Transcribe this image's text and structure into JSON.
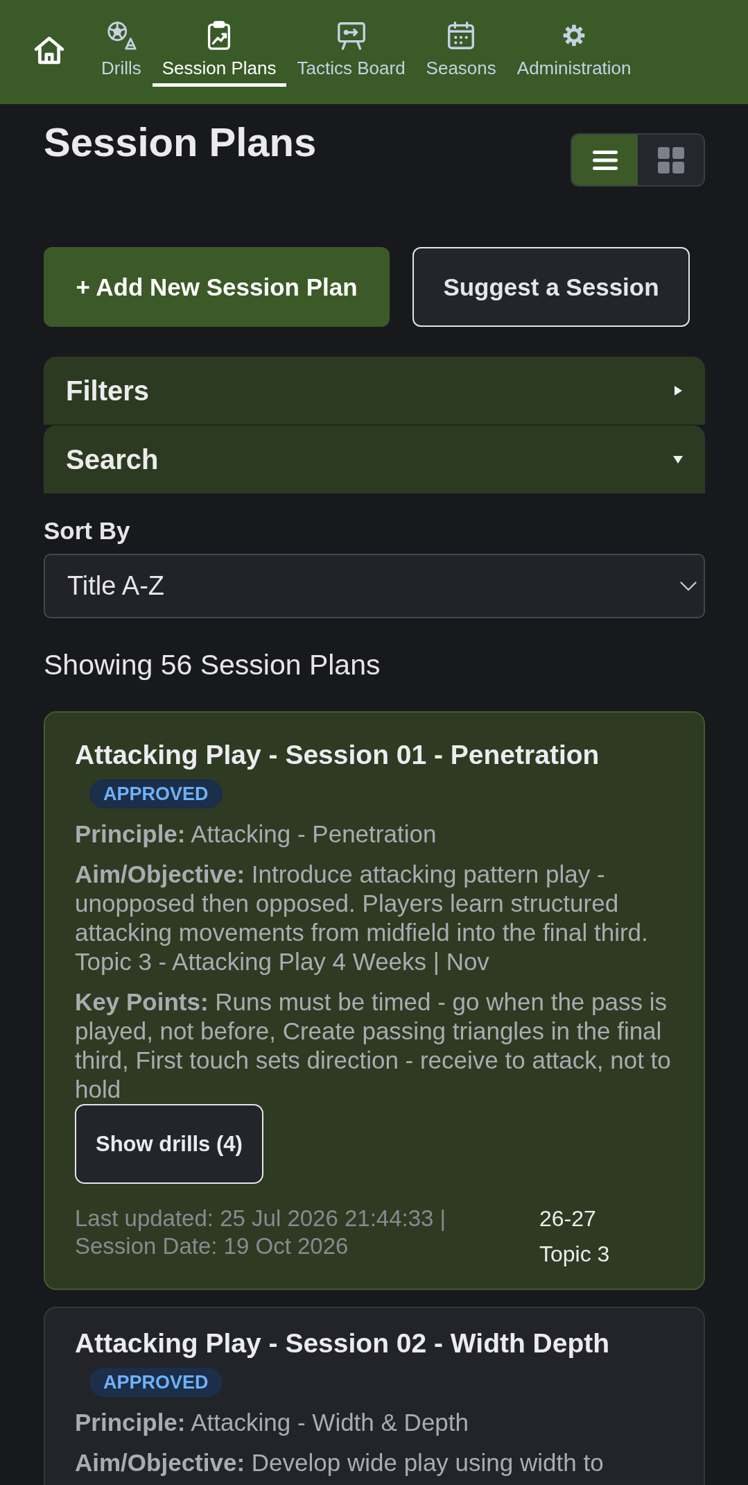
{
  "nav": {
    "items": [
      {
        "label": "Drills",
        "selected": false
      },
      {
        "label": "Session Plans",
        "selected": true
      },
      {
        "label": "Tactics Board",
        "selected": false
      },
      {
        "label": "Seasons",
        "selected": false
      },
      {
        "label": "Administration",
        "selected": false
      }
    ]
  },
  "header": {
    "title": "Session Plans",
    "view_toggle": [
      {
        "kind": "list",
        "selected": true
      },
      {
        "kind": "grid",
        "selected": false
      }
    ]
  },
  "actions": [
    {
      "label": "+ Add New Session Plan",
      "kind": "primary"
    },
    {
      "label": "Suggest a Session",
      "kind": "secondary"
    }
  ],
  "panels": [
    {
      "label": "Filters",
      "expanded": false
    },
    {
      "label": "Search",
      "expanded": true
    }
  ],
  "sort": {
    "label": "Sort By",
    "value": "Title A-Z"
  },
  "count": "Showing 56 Session Plans",
  "plans": [
    {
      "title": "Attacking Play - Session 01 - Penetration",
      "status": "APPROVED",
      "selected": true,
      "details": [
        "**Principle:** Attacking - Penetration",
        "**Aim/Objective:** Introduce attacking pattern play - unopposed then opposed. Players learn structured attacking movements from midfield into the final third. Topic 3 - Attacking Play 4 Weeks | Nov",
        "**Key Points:** Runs must be timed - go when the pass is played, not before, Create passing triangles in the final third, First touch sets direction - receive to attack, not to hold"
      ],
      "drills_button": "Show drills (4)",
      "meta": "Last updated: 25 Jul 2026 21:44:33 | Session Date: 19 Oct 2026",
      "season": "26-27",
      "topic": "Topic 3"
    },
    {
      "title": "Attacking Play - Session 02 - Width Depth",
      "status": "APPROVED",
      "selected": false,
      "details": [
        "**Principle:** Attacking - Width & Depth",
        "**Aim/Objective:** Develop wide play using width to"
      ]
    }
  ]
}
